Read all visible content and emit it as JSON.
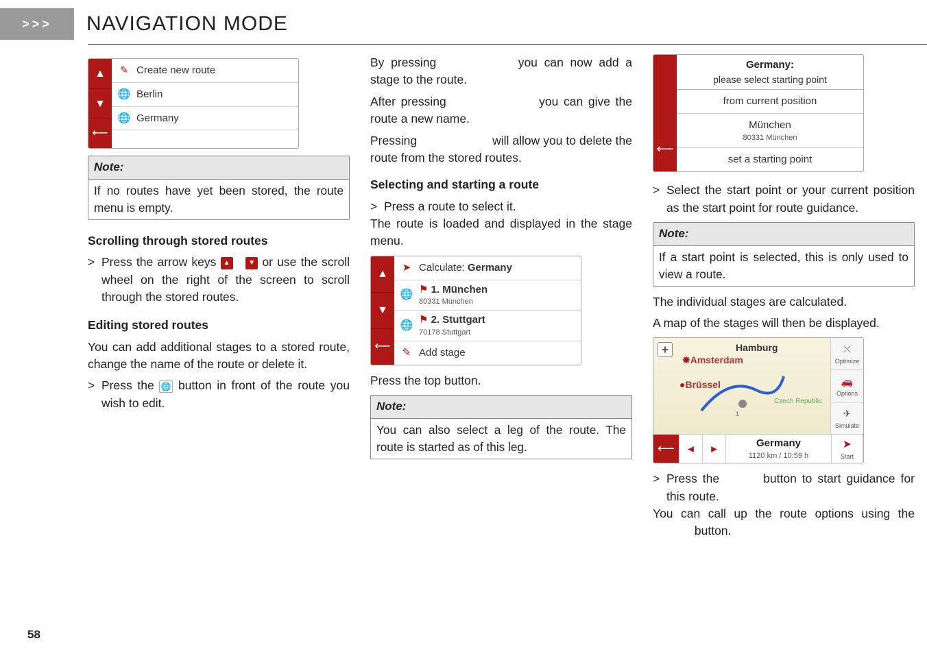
{
  "header": {
    "chevron": ">>>",
    "title": "NAVIGATION MODE"
  },
  "page_number": "58",
  "col1": {
    "routes_ui": {
      "row1": "Create new route",
      "row2": "Berlin",
      "row3": "Germany"
    },
    "note1_head": "Note:",
    "note1_body": "If no routes have yet been stored, the route menu is empty.",
    "h_scroll": "Scrolling through stored routes",
    "scroll_step_prefix": "Press the arrow keys ",
    "scroll_step_suffix": " or use the scroll wheel on the right of the screen to scroll through the stored routes.",
    "h_edit": "Editing stored routes",
    "edit_para": "You can add additional stages to a stored route, change the name of the route or delete it.",
    "edit_step_prefix": "Press the ",
    "edit_step_suffix": " button in front of the route you wish to edit."
  },
  "col2": {
    "p1a": "By pressing ",
    "p1b": " you can now add a stage to the route.",
    "p2a": "After pressing ",
    "p2b": " you can give the route a new name.",
    "p3a": "Pressing ",
    "p3b": " will allow you to delete the route from the stored routes.",
    "h_select": "Selecting and starting a route",
    "select_step": "Press a route to select it.",
    "select_para": "The route is loaded and displayed in the stage menu.",
    "stage_ui": {
      "top_prefix": "Calculate:",
      "top_bold": "Germany",
      "r1_t": "1. München",
      "r1_s": "80331 München",
      "r2_t": "2. Stuttgart",
      "r2_s": "70178 Stuttgart",
      "r3": "Add stage"
    },
    "press_top": "Press the top button.",
    "note2_head": "Note:",
    "note2_body": "You can also select a leg of the route. The route is started as of this leg."
  },
  "col3": {
    "start_ui": {
      "head_t": "Germany:",
      "head_s": "please select starting point",
      "r1": "from current position",
      "r2_t": "München",
      "r2_s": "80331 München",
      "r3": "set a starting point"
    },
    "step_startpoint": "Select the start point or your current position as the start point for route guidance.",
    "note3_head": "Note:",
    "note3_body": "If a start point is selected, this is only used to view a route.",
    "calc_para1": "The individual stages are calculated.",
    "calc_para2": "A map of the stages will then be displayed.",
    "map": {
      "hamburg": "Hamburg",
      "amsterdam": "Amsterdam",
      "brussel": "Brüssel",
      "czech": "Czech Republic",
      "opt": "Optimize",
      "opts": "Options",
      "sim": "Simulate",
      "start": "Start",
      "country": "Germany",
      "dist": "1120 km / 10:59 h"
    },
    "press_start_a": "Press the ",
    "press_start_b": " button to start guidance for this route.",
    "options_a": "You can call up the route options using the ",
    "options_b": " button."
  }
}
